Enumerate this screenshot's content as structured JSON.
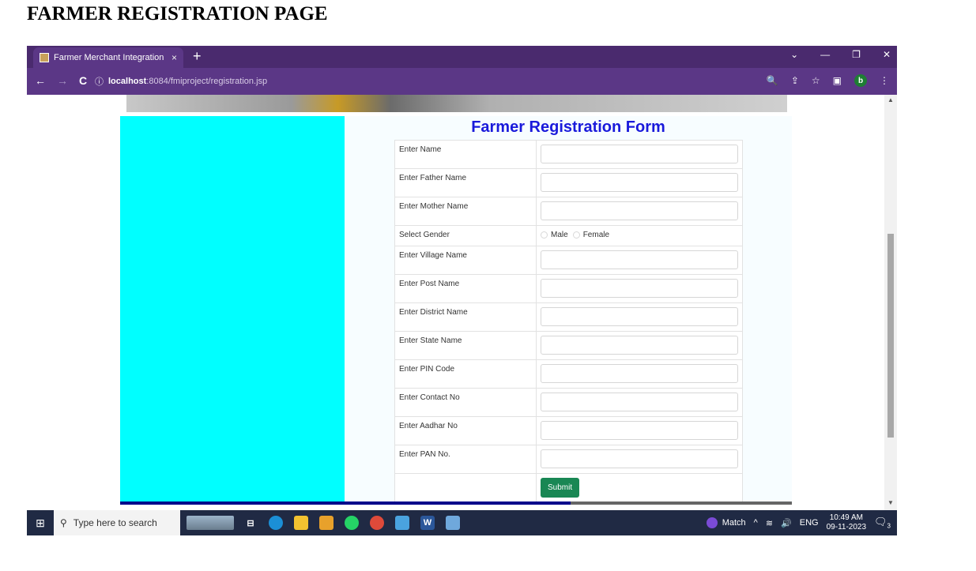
{
  "page_heading": "FARMER REGISTRATION PAGE",
  "browser": {
    "tab_title": "Farmer Merchant Integration",
    "tab_close": "×",
    "new_tab": "+",
    "window_controls": [
      "⌄",
      "—",
      "❐",
      "✕"
    ],
    "nav": {
      "back": "←",
      "forward": "→",
      "reload": "C"
    },
    "url_info_icon": "ⓘ",
    "url_host": "localhost",
    "url_path": ":8084/fmiproject/registration.jsp",
    "tools": [
      "🔍",
      "⇪",
      "☆",
      "▣"
    ],
    "profile_initial": "b",
    "menu": "⋮"
  },
  "form": {
    "title": "Farmer Registration Form",
    "fields": [
      {
        "label": "Enter Name"
      },
      {
        "label": "Enter Father Name"
      },
      {
        "label": "Enter Mother Name"
      }
    ],
    "gender": {
      "label": "Select Gender",
      "options": [
        "Male",
        "Female"
      ]
    },
    "fields2": [
      {
        "label": "Enter Village Name"
      },
      {
        "label": "Enter Post Name"
      },
      {
        "label": "Enter District Name"
      },
      {
        "label": "Enter State Name"
      },
      {
        "label": "Enter PIN Code"
      },
      {
        "label": "Enter Contact No"
      },
      {
        "label": "Enter Aadhar No"
      },
      {
        "label": "Enter PAN No."
      }
    ],
    "submit_label": "Submit"
  },
  "page_progress": 0.67,
  "taskbar": {
    "search_placeholder": "Type here to search",
    "tray_label": "Match",
    "lang": "ENG",
    "time": "10:49 AM",
    "date": "09-11-2023",
    "notification_count": "3"
  },
  "colors": {
    "chrome_dark": "#4a2a6e",
    "chrome": "#5b3786",
    "cyan_panel": "#00ffff",
    "title_blue": "#1a1adb",
    "submit_green": "#198754"
  }
}
